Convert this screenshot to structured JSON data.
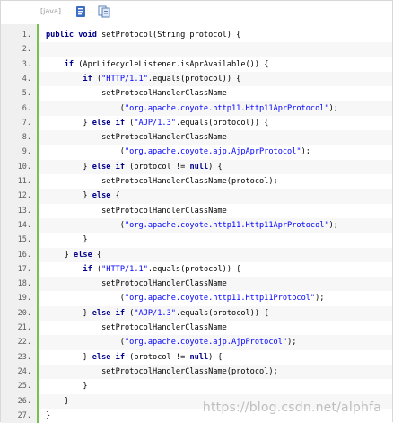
{
  "toolbar": {
    "language_label": "[java]",
    "buttons": [
      {
        "name": "view-plain-icon",
        "tooltip": "view plain"
      },
      {
        "name": "copy-icon",
        "tooltip": "copy"
      }
    ]
  },
  "colors": {
    "gutter_border": "#77c04d",
    "keyword": "#00008b",
    "string": "#0000ff",
    "watermark": "#b4b4b4"
  },
  "lines": [
    {
      "num": "1.",
      "tokens": [
        {
          "t": "kw",
          "v": "public"
        },
        {
          "t": "plain",
          "v": " "
        },
        {
          "t": "kw",
          "v": "void"
        },
        {
          "t": "plain",
          "v": " setProtocol(String protocol) {"
        }
      ]
    },
    {
      "num": "2.",
      "tokens": []
    },
    {
      "num": "3.",
      "tokens": [
        {
          "t": "plain",
          "v": "    "
        },
        {
          "t": "kw",
          "v": "if"
        },
        {
          "t": "plain",
          "v": " (AprLifecycleListener.isAprAvailable()) {"
        }
      ]
    },
    {
      "num": "4.",
      "tokens": [
        {
          "t": "plain",
          "v": "        "
        },
        {
          "t": "kw",
          "v": "if"
        },
        {
          "t": "plain",
          "v": " ("
        },
        {
          "t": "str",
          "v": "\"HTTP/1.1\""
        },
        {
          "t": "plain",
          "v": ".equals(protocol)) {"
        }
      ]
    },
    {
      "num": "5.",
      "tokens": [
        {
          "t": "plain",
          "v": "            setProtocolHandlerClassName"
        }
      ]
    },
    {
      "num": "6.",
      "tokens": [
        {
          "t": "plain",
          "v": "                ("
        },
        {
          "t": "str",
          "v": "\"org.apache.coyote.http11.Http11AprProtocol\""
        },
        {
          "t": "plain",
          "v": ");"
        }
      ]
    },
    {
      "num": "7.",
      "tokens": [
        {
          "t": "plain",
          "v": "        } "
        },
        {
          "t": "kw",
          "v": "else"
        },
        {
          "t": "plain",
          "v": " "
        },
        {
          "t": "kw",
          "v": "if"
        },
        {
          "t": "plain",
          "v": " ("
        },
        {
          "t": "str",
          "v": "\"AJP/1.3\""
        },
        {
          "t": "plain",
          "v": ".equals(protocol)) {"
        }
      ]
    },
    {
      "num": "8.",
      "tokens": [
        {
          "t": "plain",
          "v": "            setProtocolHandlerClassName"
        }
      ]
    },
    {
      "num": "9.",
      "tokens": [
        {
          "t": "plain",
          "v": "                ("
        },
        {
          "t": "str",
          "v": "\"org.apache.coyote.ajp.AjpAprProtocol\""
        },
        {
          "t": "plain",
          "v": ");"
        }
      ]
    },
    {
      "num": "10.",
      "tokens": [
        {
          "t": "plain",
          "v": "        } "
        },
        {
          "t": "kw",
          "v": "else"
        },
        {
          "t": "plain",
          "v": " "
        },
        {
          "t": "kw",
          "v": "if"
        },
        {
          "t": "plain",
          "v": " (protocol != "
        },
        {
          "t": "kw",
          "v": "null"
        },
        {
          "t": "plain",
          "v": ") {"
        }
      ]
    },
    {
      "num": "11.",
      "tokens": [
        {
          "t": "plain",
          "v": "            setProtocolHandlerClassName(protocol);"
        }
      ]
    },
    {
      "num": "12.",
      "tokens": [
        {
          "t": "plain",
          "v": "        } "
        },
        {
          "t": "kw",
          "v": "else"
        },
        {
          "t": "plain",
          "v": " {"
        }
      ]
    },
    {
      "num": "13.",
      "tokens": [
        {
          "t": "plain",
          "v": "            setProtocolHandlerClassName"
        }
      ]
    },
    {
      "num": "14.",
      "tokens": [
        {
          "t": "plain",
          "v": "                ("
        },
        {
          "t": "str",
          "v": "\"org.apache.coyote.http11.Http11AprProtocol\""
        },
        {
          "t": "plain",
          "v": ");"
        }
      ]
    },
    {
      "num": "15.",
      "tokens": [
        {
          "t": "plain",
          "v": "        }"
        }
      ]
    },
    {
      "num": "16.",
      "tokens": [
        {
          "t": "plain",
          "v": "    } "
        },
        {
          "t": "kw",
          "v": "else"
        },
        {
          "t": "plain",
          "v": " {"
        }
      ]
    },
    {
      "num": "17.",
      "tokens": [
        {
          "t": "plain",
          "v": "        "
        },
        {
          "t": "kw",
          "v": "if"
        },
        {
          "t": "plain",
          "v": " ("
        },
        {
          "t": "str",
          "v": "\"HTTP/1.1\""
        },
        {
          "t": "plain",
          "v": ".equals(protocol)) {"
        }
      ]
    },
    {
      "num": "18.",
      "tokens": [
        {
          "t": "plain",
          "v": "            setProtocolHandlerClassName"
        }
      ]
    },
    {
      "num": "19.",
      "tokens": [
        {
          "t": "plain",
          "v": "                ("
        },
        {
          "t": "str",
          "v": "\"org.apache.coyote.http11.Http11Protocol\""
        },
        {
          "t": "plain",
          "v": ");"
        }
      ]
    },
    {
      "num": "20.",
      "tokens": [
        {
          "t": "plain",
          "v": "        } "
        },
        {
          "t": "kw",
          "v": "else"
        },
        {
          "t": "plain",
          "v": " "
        },
        {
          "t": "kw",
          "v": "if"
        },
        {
          "t": "plain",
          "v": " ("
        },
        {
          "t": "str",
          "v": "\"AJP/1.3\""
        },
        {
          "t": "plain",
          "v": ".equals(protocol)) {"
        }
      ]
    },
    {
      "num": "21.",
      "tokens": [
        {
          "t": "plain",
          "v": "            setProtocolHandlerClassName"
        }
      ]
    },
    {
      "num": "22.",
      "tokens": [
        {
          "t": "plain",
          "v": "                ("
        },
        {
          "t": "str",
          "v": "\"org.apache.coyote.ajp.AjpProtocol\""
        },
        {
          "t": "plain",
          "v": ");"
        }
      ]
    },
    {
      "num": "23.",
      "tokens": [
        {
          "t": "plain",
          "v": "        } "
        },
        {
          "t": "kw",
          "v": "else"
        },
        {
          "t": "plain",
          "v": " "
        },
        {
          "t": "kw",
          "v": "if"
        },
        {
          "t": "plain",
          "v": " (protocol != "
        },
        {
          "t": "kw",
          "v": "null"
        },
        {
          "t": "plain",
          "v": ") {"
        }
      ]
    },
    {
      "num": "24.",
      "tokens": [
        {
          "t": "plain",
          "v": "            setProtocolHandlerClassName(protocol);"
        }
      ]
    },
    {
      "num": "25.",
      "tokens": [
        {
          "t": "plain",
          "v": "        }"
        }
      ]
    },
    {
      "num": "26.",
      "tokens": [
        {
          "t": "plain",
          "v": "    }"
        }
      ]
    },
    {
      "num": "27.",
      "tokens": [
        {
          "t": "plain",
          "v": "}"
        }
      ]
    }
  ],
  "watermark": "https://blog.csdn.net/alphfa"
}
